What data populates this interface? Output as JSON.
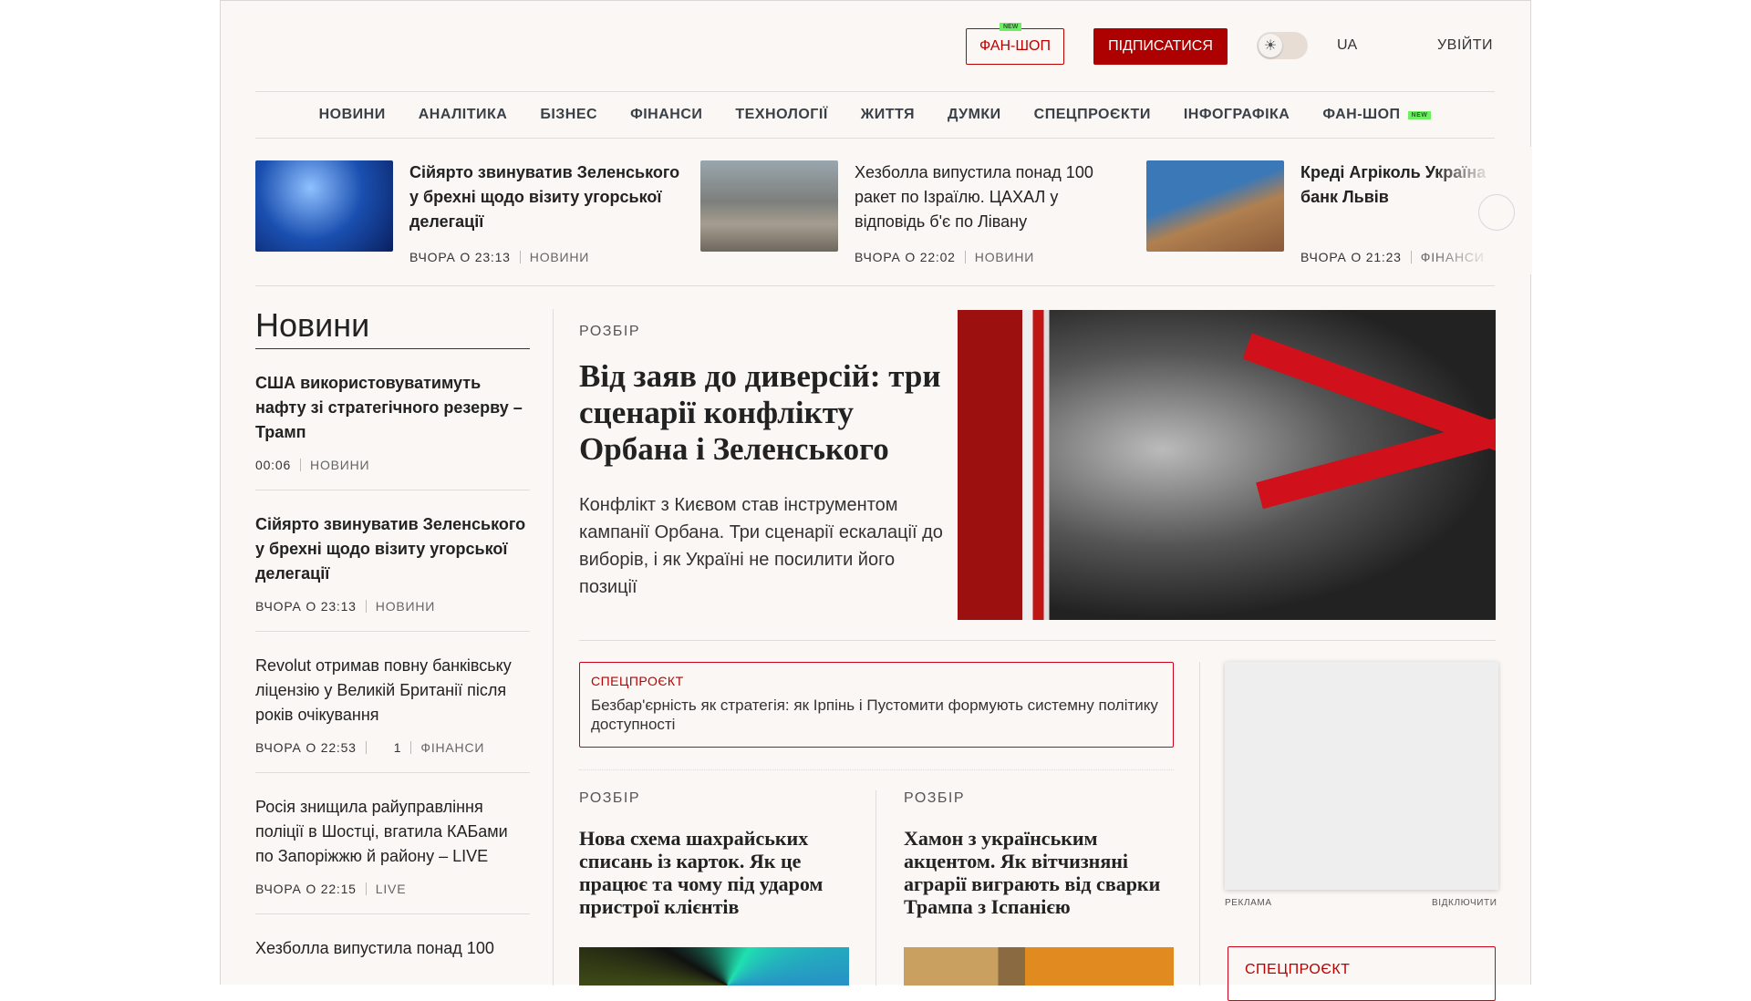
{
  "header": {
    "shop_label": "ФАН-ШОП",
    "new_badge": "NEW",
    "subscribe_label": "ПІДПИСАТИСЯ",
    "lang": "UA",
    "login": "УВІЙТИ"
  },
  "nav": [
    "НОВИНИ",
    "АНАЛІТИКА",
    "БІЗНЕС",
    "ФІНАНСИ",
    "ТЕХНОЛОГІЇ",
    "ЖИТТЯ",
    "ДУМКИ",
    "СПЕЦПРОЄКТИ",
    "ІНФОГРАФІКА",
    "ФАН-ШОП"
  ],
  "strip": [
    {
      "title": "Сійярто звинуватив Зеленського у брехні щодо візиту угорської делегації",
      "time": "ВЧОРА О 23:13",
      "category": "НОВИНИ"
    },
    {
      "title": "Хезболла випустила понад 100 ракет по Ізраїлю. ЦАХАЛ у відповідь б'є по Лівану",
      "time": "ВЧОРА О 22:02",
      "category": "НОВИНИ"
    },
    {
      "title": "Креді Агріколь Україна банк Львів",
      "time": "ВЧОРА О 21:23",
      "category": "ФІНАНСИ"
    }
  ],
  "news": {
    "heading": "Новини",
    "items": [
      {
        "title": "США використовуватимуть нафту зі стратегічного резерву – Трамп",
        "time": "00:06",
        "category": "НОВИНИ"
      },
      {
        "title": "Сійярто звинуватив Зеленського у брехні щодо візиту угорської делегації",
        "time": "ВЧОРА О 23:13",
        "category": "НОВИНИ"
      },
      {
        "title": "Revolut отримав повну банківську ліцензію у Великій Британії після років очікування",
        "time": "ВЧОРА О 22:53",
        "comments": "1",
        "category": "ФІНАНСИ"
      },
      {
        "title": "Росія знищила райуправління поліції в Шостці, вгатила КАБами по Запоріжжю й району – LIVE",
        "time": "ВЧОРА О 22:15",
        "category": "LIVE"
      },
      {
        "title": "Хезболла випустила понад 100"
      }
    ]
  },
  "lead": {
    "kicker": "РОЗБІР",
    "title": "Від заяв до диверсій: три сценарії конфлікту Орбана і Зеленського",
    "lead": "Конфлікт з Києвом став інструментом кампанії Орбана. Три сценарії ескалації до виборів, і як Україні не посилити його позиції"
  },
  "special": {
    "kicker": "СПЕЦПРОЄКТ",
    "title": "Безбар'єрність як стратегія: як Ірпінь і Пустомити формують системну політику доступності"
  },
  "cards": [
    {
      "kicker": "РОЗБІР",
      "title": "Нова схема шахрайських списань із карток. Як це працює та чому під ударом пристрої клієнтів"
    },
    {
      "kicker": "РОЗБІР",
      "title": "Хамон з українським акцентом. Як вітчизняні аграрії виграють від сварки Трампа з Іспанією"
    }
  ],
  "ad": {
    "label": "РЕКЛАМА",
    "disable": "ВІДКЛЮЧИТИ"
  },
  "side_special": {
    "kicker": "СПЕЦПРОЄКТ"
  }
}
